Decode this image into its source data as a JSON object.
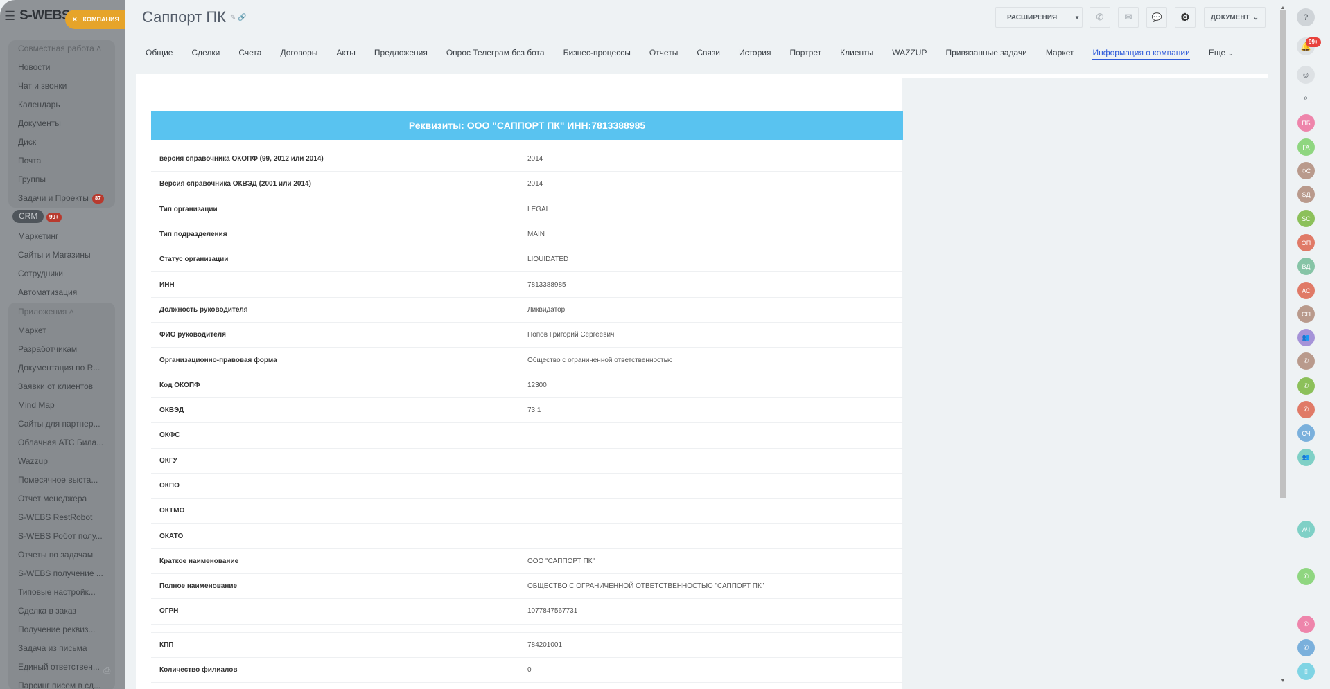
{
  "sidebar": {
    "logo": "S-WEBS",
    "company_button": "КОМПАНИЯ",
    "group1_title": "Совместная работа",
    "group1": [
      "Новости",
      "Чат и звонки",
      "Календарь",
      "Документы",
      "Диск",
      "Почта",
      "Группы",
      "Задачи и Проекты"
    ],
    "tasks_badge": "87",
    "crm": "CRM",
    "crm_badge": "99+",
    "items": [
      "Маркетинг",
      "Сайты и Магазины",
      "Сотрудники",
      "Автоматизация"
    ],
    "group2_title": "Приложения",
    "group2": [
      "Маркет",
      "Разработчикам",
      "Документация по R...",
      "Заявки от клиентов",
      "Mind Map",
      "Сайты для партнер...",
      "Облачная АТС Била...",
      "Wazzup",
      "Помесячное выста...",
      "Отчет менеджера",
      "S-WEBS RestRobot",
      "S-WEBS Робот полу...",
      "Отчеты по задачам",
      "S-WEBS получение ...",
      "Типовые настройк...",
      "Сделка в заказ",
      "Получение реквиз...",
      "Задача из письма",
      "Единый ответствен...",
      "Парсинг писем в сд..."
    ]
  },
  "header": {
    "title": "Саппорт ПК",
    "extensions": "РАСШИРЕНИЯ",
    "document": "ДОКУМЕНТ"
  },
  "tabs": [
    "Общие",
    "Сделки",
    "Счета",
    "Договоры",
    "Акты",
    "Предложения",
    "Опрос Телеграм без бота",
    "Бизнес-процессы",
    "Отчеты",
    "Связи",
    "История",
    "Портрет",
    "Клиенты",
    "WAZZUP",
    "Привязанные задачи",
    "Маркет",
    "Информация о компании",
    "Еще"
  ],
  "active_tab": "Информация о компании",
  "banner": "Реквизиты: ООО \"САППОРТ ПК\" ИНН:7813388985",
  "rows": [
    {
      "label": "версия справочника ОКОПФ (99, 2012 или 2014)",
      "value": "2014"
    },
    {
      "label": "Версия справочника ОКВЭД (2001 или 2014)",
      "value": "2014"
    },
    {
      "label": "Тип организации",
      "value": "LEGAL"
    },
    {
      "label": "Тип подразделения",
      "value": "MAIN"
    },
    {
      "label": "Статус организации",
      "value": "LIQUIDATED"
    },
    {
      "label": "ИНН",
      "value": "7813388985"
    },
    {
      "label": "Должность руководителя",
      "value": "Ликвидатор"
    },
    {
      "label": "ФИО руководителя",
      "value": "Попов Григорий Сергеевич"
    },
    {
      "label": "Организационно-правовая форма",
      "value": "Общество с ограниченной ответственностью"
    },
    {
      "label": "Код ОКОПФ",
      "value": "12300"
    },
    {
      "label": "ОКВЭД",
      "value": "73.1"
    },
    {
      "label": "ОКФС",
      "value": ""
    },
    {
      "label": "ОКГУ",
      "value": ""
    },
    {
      "label": "ОКПО",
      "value": ""
    },
    {
      "label": "ОКТМО",
      "value": ""
    },
    {
      "label": "ОКАТО",
      "value": ""
    },
    {
      "label": "Краткое наименование",
      "value": "ООО \"САППОРТ ПК\""
    },
    {
      "label": "Полное наименование",
      "value": "ОБЩЕСТВО С ОГРАНИЧЕННОЙ ОТВЕТСТВЕННОСТЬЮ \"САППОРТ ПК\""
    },
    {
      "label": "ОГРН",
      "value": "1077847567731"
    },
    {
      "spacer": true
    },
    {
      "label": "КПП",
      "value": "784201001"
    },
    {
      "label": "Количество филиалов",
      "value": "0"
    }
  ],
  "right_bar": {
    "notif_badge": "99+",
    "avatars": [
      {
        "text": "ПБ",
        "color": "#ee85ab"
      },
      {
        "text": "ГА",
        "color": "#8fd680"
      },
      {
        "text": "ФС",
        "color": "#b99a8c"
      },
      {
        "text": "SД",
        "color": "#b99a8c"
      },
      {
        "text": "SC",
        "color": "#8cc05a"
      },
      {
        "text": "ОП",
        "color": "#e07a67"
      },
      {
        "text": "ВД",
        "color": "#86c4a6"
      },
      {
        "text": "АС",
        "color": "#e07a67"
      },
      {
        "text": "СП",
        "color": "#b99a8c"
      },
      {
        "text": "👥",
        "color": "#a593d8"
      },
      {
        "text": "✆",
        "color": "#b99a8c"
      },
      {
        "text": "✆",
        "color": "#8cc05a"
      },
      {
        "text": "✆",
        "color": "#e07a67"
      },
      {
        "text": "СЧ",
        "color": "#7ab0dc"
      },
      {
        "text": "👥",
        "color": "#7fd0c6"
      },
      {
        "text": "АЧ",
        "color": "#7fd0c6"
      },
      {
        "text": "✆",
        "color": "#8fd680"
      },
      {
        "text": "✆",
        "color": "#ee85ab"
      },
      {
        "text": "✆",
        "color": "#7ab0dc"
      },
      {
        "text": "▯",
        "color": "#7fd4e4"
      }
    ]
  }
}
